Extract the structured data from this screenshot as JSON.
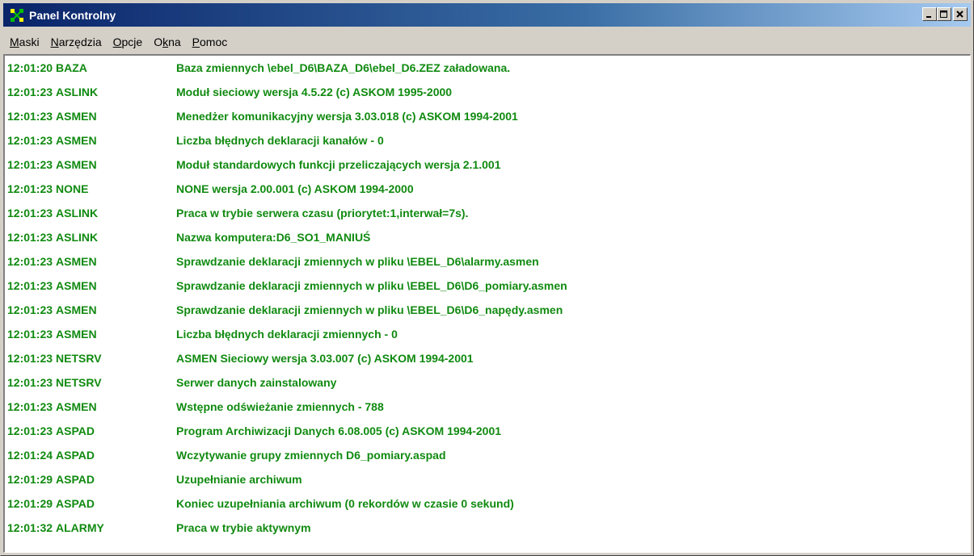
{
  "window": {
    "title": "Panel Kontrolny",
    "icon": "network-icon",
    "controls": {
      "minimize": "_",
      "maximize": "□",
      "close": "×"
    }
  },
  "menu": [
    {
      "label": "Maski",
      "accel": "M",
      "rest": "aski"
    },
    {
      "label": "Narzędzia",
      "accel": "N",
      "rest": "arzędzia"
    },
    {
      "label": "Opcje",
      "accel": "O",
      "rest": "pcje"
    },
    {
      "label": "Okna",
      "accel": "O",
      "pre": "O",
      "acc2": "k",
      "rest": "na"
    },
    {
      "label": "Pomoc",
      "accel": "P",
      "rest": "omoc"
    }
  ],
  "colors": {
    "log_text": "#108a10",
    "title_bar_start": "#0a246a",
    "title_bar_end": "#a6caf0"
  },
  "log": [
    {
      "time": "12:01:20",
      "source": "BAZA",
      "message": "Baza zmiennych \\ebel_D6\\BAZA_D6\\ebel_D6.ZEZ załadowana."
    },
    {
      "time": "12:01:23",
      "source": "ASLINK",
      "message": "Moduł sieciowy wersja 4.5.22 (c) ASKOM 1995-2000"
    },
    {
      "time": "12:01:23",
      "source": "ASMEN",
      "message": "Menedżer komunikacyjny wersja 3.03.018 (c) ASKOM 1994-2001"
    },
    {
      "time": "12:01:23",
      "source": "ASMEN",
      "message": "Liczba błędnych deklaracji kanałów - 0"
    },
    {
      "time": "12:01:23",
      "source": "ASMEN",
      "message": "Moduł standardowych funkcji przeliczających wersja 2.1.001"
    },
    {
      "time": "12:01:23",
      "source": "NONE",
      "message": "NONE wersja 2.00.001 (c) ASKOM 1994-2000"
    },
    {
      "time": "12:01:23",
      "source": "ASLINK",
      "message": "Praca w trybie serwera czasu (priorytet:1,interwał=7s)."
    },
    {
      "time": "12:01:23",
      "source": "ASLINK",
      "message": "Nazwa komputera:D6_SO1_MANIUŚ"
    },
    {
      "time": "12:01:23",
      "source": "ASMEN",
      "message": "Sprawdzanie deklaracji zmiennych w pliku \\EBEL_D6\\alarmy.asmen"
    },
    {
      "time": "12:01:23",
      "source": "ASMEN",
      "message": "Sprawdzanie deklaracji zmiennych w pliku \\EBEL_D6\\D6_pomiary.asmen"
    },
    {
      "time": "12:01:23",
      "source": "ASMEN",
      "message": "Sprawdzanie deklaracji zmiennych w pliku \\EBEL_D6\\D6_napędy.asmen"
    },
    {
      "time": "12:01:23",
      "source": "ASMEN",
      "message": "Liczba błędnych deklaracji zmiennych - 0"
    },
    {
      "time": "12:01:23",
      "source": "NETSRV",
      "message": "ASMEN Sieciowy wersja 3.03.007 (c) ASKOM 1994-2001"
    },
    {
      "time": "12:01:23",
      "source": "NETSRV",
      "message": "Serwer danych zainstalowany"
    },
    {
      "time": "12:01:23",
      "source": "ASMEN",
      "message": "Wstępne odświeżanie zmiennych - 788"
    },
    {
      "time": "12:01:23",
      "source": "ASPAD",
      "message": "Program Archiwizacji Danych 6.08.005   (c) ASKOM 1994-2001"
    },
    {
      "time": "12:01:24",
      "source": "ASPAD",
      "message": "Wczytywanie grupy zmiennych D6_pomiary.aspad"
    },
    {
      "time": "12:01:29",
      "source": "ASPAD",
      "message": "Uzupełnianie archiwum"
    },
    {
      "time": "12:01:29",
      "source": "ASPAD",
      "message": "Koniec uzupełniania archiwum (0 rekordów w czasie 0 sekund)"
    },
    {
      "time": "12:01:32",
      "source": "ALARMY",
      "message": "Praca w trybie aktywnym"
    }
  ]
}
